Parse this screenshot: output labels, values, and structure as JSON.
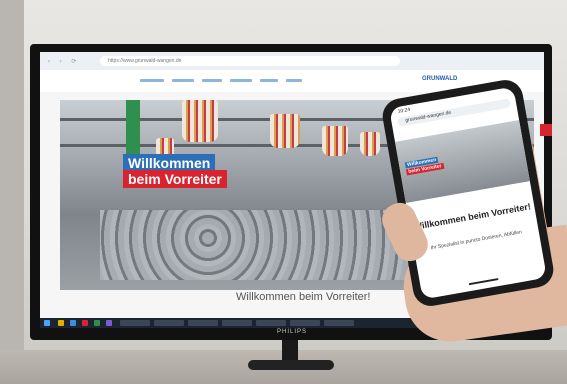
{
  "monitor": {
    "url": "https://www.grunwald-wangen.de",
    "brand": "GRUNWALD",
    "hero_badge_line1": "Willkommen",
    "hero_badge_line2": "beim Vorreiter",
    "page_heading": "Willkommen beim Vorreiter!",
    "maker": "PHILIPS"
  },
  "phone": {
    "time": "10:24",
    "url": "grunwald-wangen.de",
    "hero_badge_line1": "Willkommen",
    "hero_badge_line2": "beim Vorreiter",
    "title": "Willkommen beim Vorreiter!",
    "subtitle": "Ihr Spezialist in puncto Dosieren, Abfüllen"
  },
  "colors": {
    "brand_blue": "#2a6fb8",
    "brand_red": "#d9232e",
    "green": "#2f8f4e"
  }
}
